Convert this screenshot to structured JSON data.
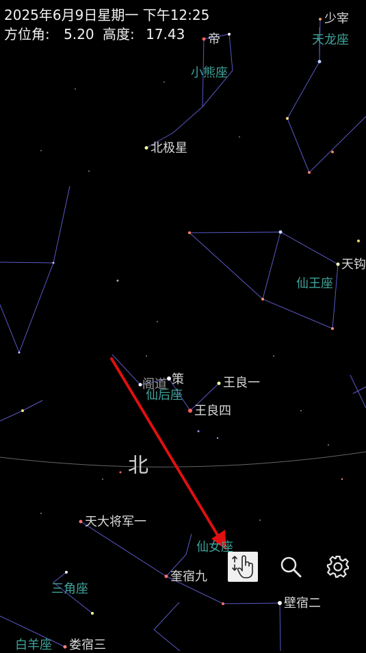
{
  "header": {
    "datetime": "2025年6月9日星期一 下午12:25",
    "azimuth_label": "方位角:",
    "azimuth_value": "5.20",
    "altitude_label": "高度:",
    "altitude_value": "17.43"
  },
  "star_labels": {
    "shaozai": "少宰",
    "di": "帝",
    "beiji": "北极星",
    "tiangou": "天钩",
    "gedao": "阁道",
    "ce": "策",
    "wangliangyi": "王良一",
    "wangliangsi": "王良四",
    "tiandajiangjun": "天大将军一",
    "kuisujiu": "奎宿九",
    "bisuer": "壁宿二",
    "lousan": "娄宿三"
  },
  "constellation_labels": {
    "draco": "天龙座",
    "ursa_minor": "小熊座",
    "cepheus": "仙王座",
    "cassiopeia": "仙后座",
    "andromeda": "仙女座",
    "triangulum": "三角座",
    "aries": "白羊座"
  },
  "direction_label": "北",
  "toolbar": {
    "gesture_icon": "hand-pointer-icon",
    "search_icon": "search-icon",
    "settings_icon": "gear-icon"
  },
  "colors": {
    "background": "#000000",
    "constellation_line": "#5a5ac8",
    "constellation_label": "#3fa39a",
    "arrow": "#e01010"
  }
}
